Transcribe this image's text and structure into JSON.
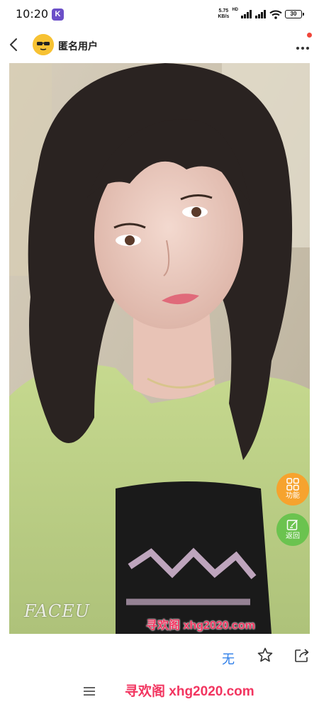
{
  "status_bar": {
    "time": "10:20",
    "app_icon_letter": "K",
    "net_speed_value": "5.75",
    "net_speed_unit": "KB/s",
    "hd_label": "HD",
    "battery": "30"
  },
  "header": {
    "username": "匿名用户"
  },
  "photo": {
    "faceu_watermark": "FACEU",
    "site_watermark": "寻欢阁 xhg2020.com"
  },
  "floating_buttons": {
    "function_label": "功能",
    "return_label": "返回"
  },
  "action_bar": {
    "no_label": "无"
  },
  "nav_bar": {
    "watermark": "寻欢阁 xhg2020.com"
  },
  "colors": {
    "accent_blue": "#2b7de9",
    "function_orange": "#f6a32e",
    "return_green": "#6bc34f",
    "watermark_pink": "#f23560"
  }
}
